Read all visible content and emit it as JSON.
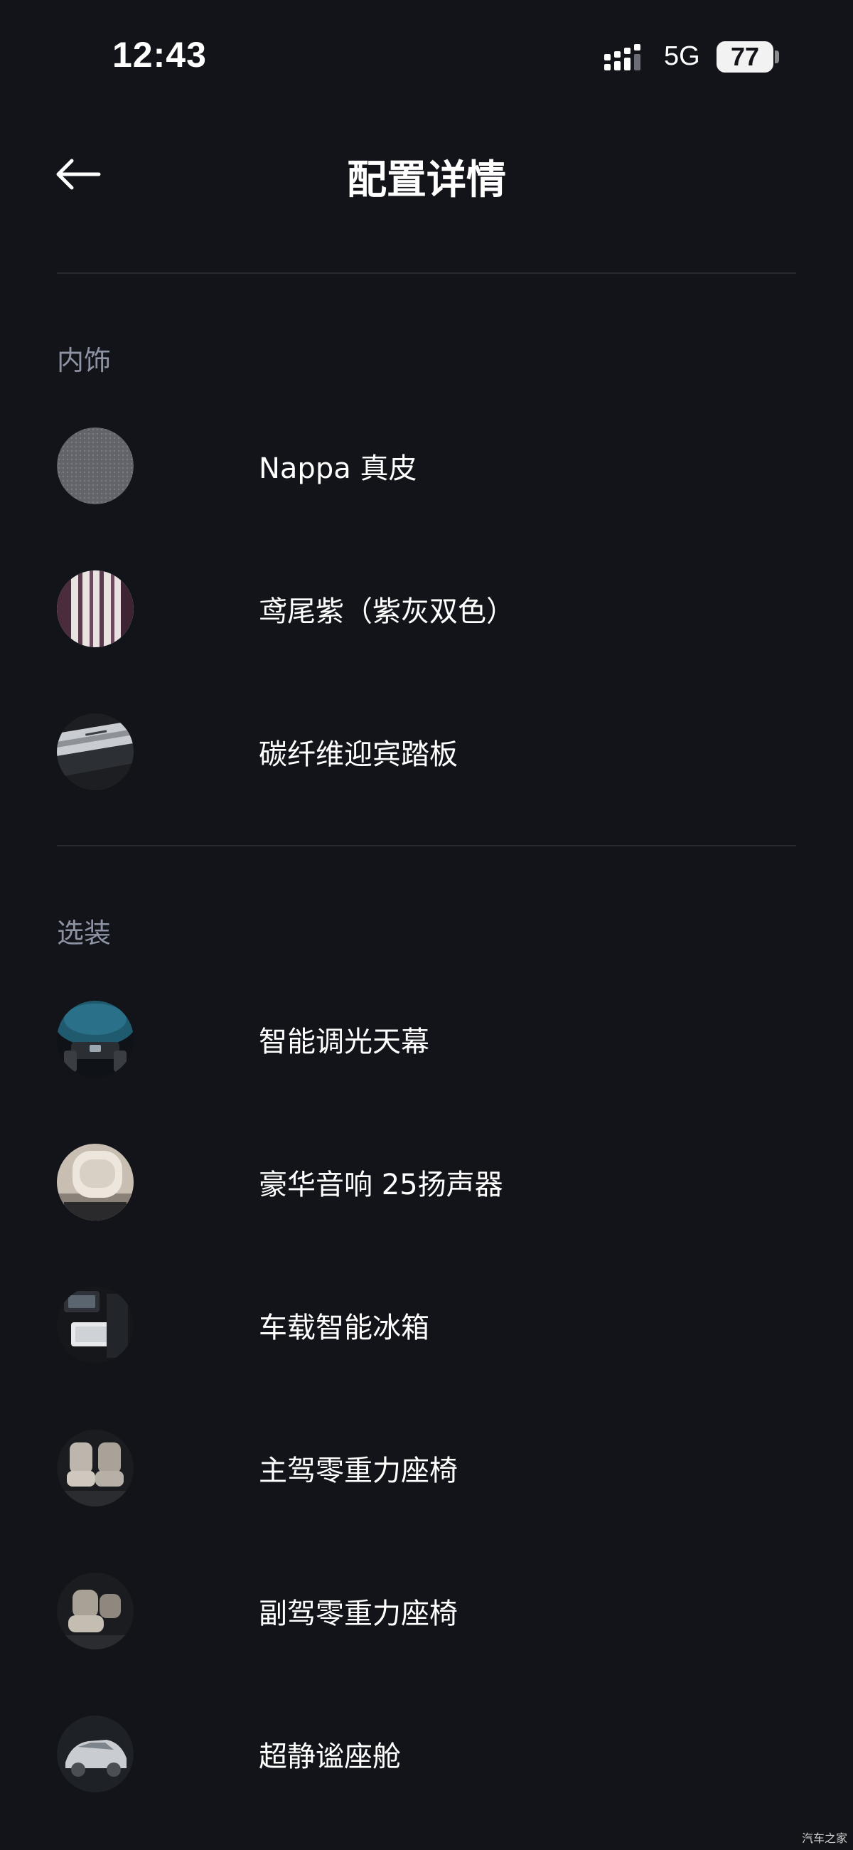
{
  "status_bar": {
    "time": "12:43",
    "network": "5G",
    "battery": "77"
  },
  "header": {
    "title": "配置详情",
    "back_icon": "arrow-left-icon"
  },
  "sections": [
    {
      "title": "内饰",
      "items": [
        {
          "label": "Nappa 真皮",
          "icon": "leather-texture"
        },
        {
          "label": "鸢尾紫（紫灰双色）",
          "icon": "stripe-swatch"
        },
        {
          "label": "碳纤维迎宾踏板",
          "icon": "door-sill"
        }
      ]
    },
    {
      "title": "选装",
      "items": [
        {
          "label": "智能调光天幕",
          "icon": "sky-roof"
        },
        {
          "label": "豪华音响 25扬声器",
          "icon": "headrest-speaker"
        },
        {
          "label": "车载智能冰箱",
          "icon": "fridge"
        },
        {
          "label": "主驾零重力座椅",
          "icon": "driver-seat"
        },
        {
          "label": "副驾零重力座椅",
          "icon": "passenger-seat"
        },
        {
          "label": "超静谧座舱",
          "icon": "quiet-cabin"
        }
      ]
    }
  ],
  "watermark": "汽车之家"
}
